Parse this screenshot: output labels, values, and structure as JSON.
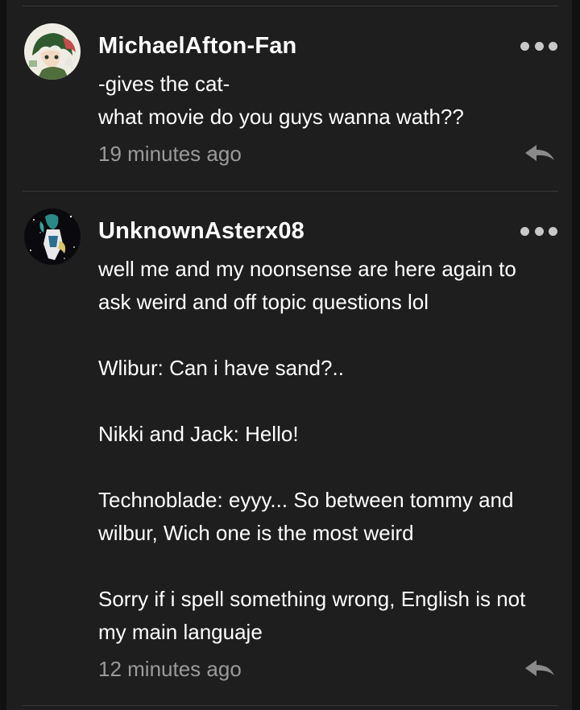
{
  "comments": [
    {
      "username": "MichaelAfton-Fan",
      "lines": [
        "-gives the cat-",
        "what movie do you guys wanna wath??"
      ],
      "timestamp": "19 minutes ago",
      "avatar_icon": "anime-avatar-green-hair"
    },
    {
      "username": "UnknownAsterx08",
      "lines": [
        "well me and my noonsense are here again to",
        "ask weird and off topic questions lol",
        "",
        "Wlibur: Can i have sand?..",
        "",
        "Nikki and Jack: Hello!",
        "",
        "Technoblade: eyyy... So between tommy and",
        "wilbur, Wich one is the most weird",
        "",
        "Sorry if i spell something wrong, English is not",
        "my main languaje"
      ],
      "timestamp": "12 minutes ago",
      "avatar_icon": "anime-avatar-dark-space"
    }
  ],
  "colors": {
    "background": "#111111",
    "panel": "#1e1e1f",
    "text": "#ffffff",
    "muted": "#9a9a9a",
    "divider": "#3a3a3c"
  },
  "icons": {
    "more": "more-options-icon",
    "reply": "reply-arrow-icon"
  }
}
